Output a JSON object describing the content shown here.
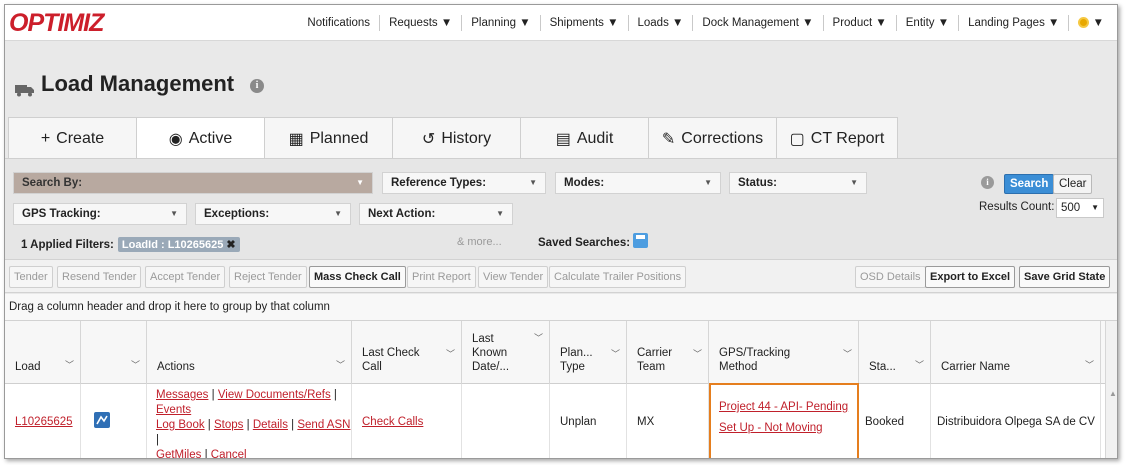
{
  "app": {
    "logo": "OPTIMIZ"
  },
  "nav": [
    "Notifications",
    "Requests ▼",
    "Planning ▼",
    "Shipments ▼",
    "Loads ▼",
    "Dock Management ▼",
    "Product ▼",
    "Entity ▼",
    "Landing Pages ▼",
    "▼"
  ],
  "page": {
    "title": "Load Management"
  },
  "tabs": [
    {
      "icon": "+",
      "label": "Create"
    },
    {
      "icon": "◉",
      "label": "Active"
    },
    {
      "icon": "▦",
      "label": "Planned"
    },
    {
      "icon": "↺",
      "label": "History"
    },
    {
      "icon": "▤",
      "label": "Audit"
    },
    {
      "icon": "✎",
      "label": "Corrections"
    },
    {
      "icon": "▢",
      "label": "CT Report"
    }
  ],
  "filters": {
    "search_by": "Search By:",
    "reference_types": "Reference Types:",
    "modes": "Modes:",
    "status": "Status:",
    "gps_tracking": "GPS Tracking:",
    "exceptions": "Exceptions:",
    "next_action": "Next Action:",
    "applied_label": "1 Applied Filters:",
    "applied_filter": "LoadId : L10265625",
    "more": "& more...",
    "saved_searches": "Saved Searches:",
    "search_btn": "Search",
    "clear_btn": "Clear",
    "results_label": "Results Count:",
    "results_value": "500"
  },
  "toolbar": {
    "tender": "Tender",
    "resend_tender": "Resend Tender",
    "accept_tender": "Accept Tender",
    "reject_tender": "Reject Tender",
    "mass_check_call": "Mass Check Call",
    "print_report": "Print Report",
    "view_tender": "View Tender",
    "calc_trailer": "Calculate Trailer Positions",
    "osd_details": "OSD Details",
    "export_excel": "Export to Excel",
    "save_grid": "Save Grid State"
  },
  "group_hint": "Drag a column header and drop it here to group by that column",
  "columns": {
    "load": "Load",
    "actions": "Actions",
    "last_check_call_1": "Last Check",
    "last_check_call_2": "Call",
    "last_known_1": "Last",
    "last_known_2": "Known",
    "last_known_3": "Date/...",
    "plan_type_1": "Plan...",
    "plan_type_2": "Type",
    "carrier_team_1": "Carrier",
    "carrier_team_2": "Team",
    "gps_1": "GPS/Tracking",
    "gps_2": "Method",
    "status": "Sta...",
    "carrier_name": "Carrier Name"
  },
  "row": {
    "load": "L10265625",
    "actions": {
      "messages": "Messages",
      "view_docs": "View Documents/Refs",
      "events": "Events",
      "log_book": "Log Book",
      "stops": "Stops",
      "details": "Details",
      "send_asn": "Send ASN",
      "getmiles": "GetMiles",
      "cancel": "Cancel"
    },
    "last_check_call": "Check Calls",
    "plan_type": "Unplan",
    "carrier_team": "MX",
    "gps_line1": "Project 44 - API- Pending",
    "gps_line2": "Set Up - Not Moving",
    "status": "Booked",
    "carrier_name": "Distribuidora Olpega SA de CV"
  },
  "colors": {
    "brand": "#cc1f2b",
    "accent": "#3b8ed6",
    "highlight": "#e57e1e"
  }
}
